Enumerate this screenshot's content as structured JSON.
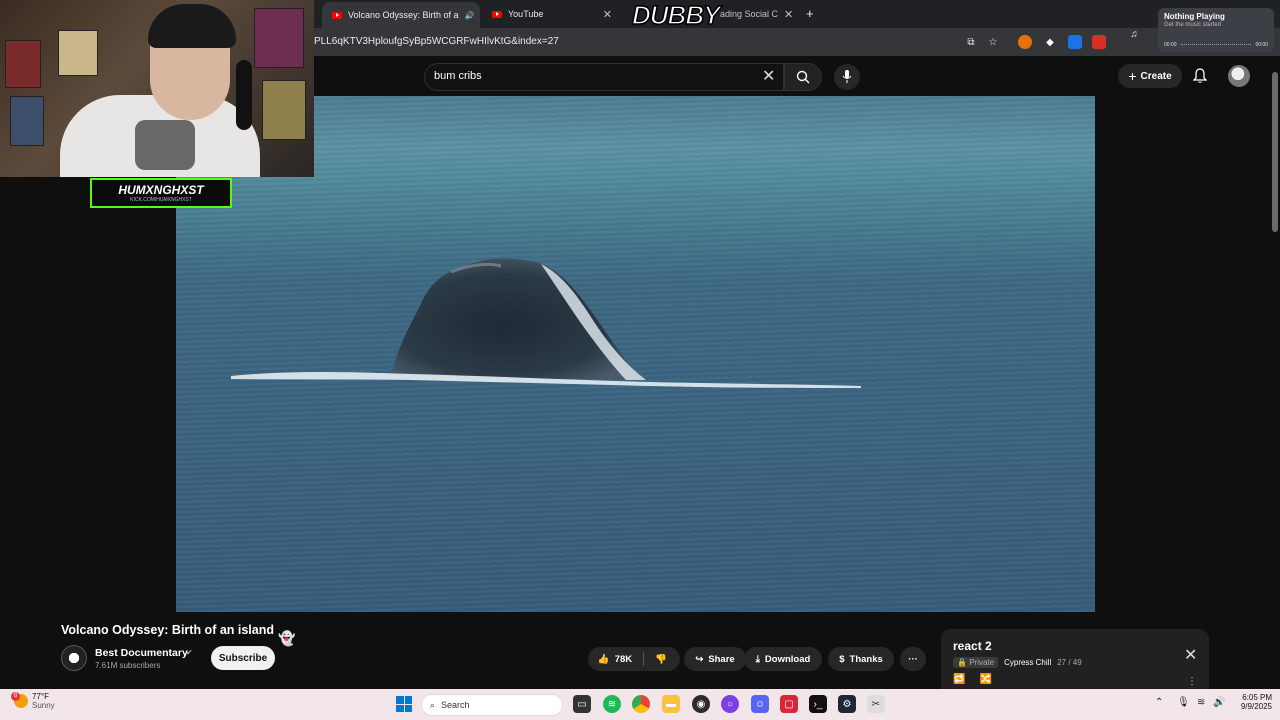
{
  "browser": {
    "tabs": [
      {
        "label": "Volcano Odyssey: Birth of a",
        "active": true
      },
      {
        "label": "YouTube",
        "active": false
      },
      {
        "label": "ading Social C",
        "active": false
      }
    ],
    "new_tab": "+",
    "url": "PLL6qKTV3HploufgSyBp5WCGRFwHIlvKtG&index=27"
  },
  "now_playing": {
    "title": "Nothing Playing",
    "subtitle": "Get the music started",
    "time_start": "00:00",
    "time_end": "00:00"
  },
  "overlay": {
    "streamer_name": "HUMXNGHXST",
    "streamer_link": "KICK.COM/HUMXNGHXST",
    "brand": "DUBBY"
  },
  "youtube": {
    "search_value": "bum cribs",
    "create_label": "Create",
    "video_title": "Volcano Odyssey: Birth of an island",
    "channel_name": "Best Documentary",
    "subscribers": "7.61M subscribers",
    "subscribe_label": "Subscribe",
    "like_count": "78K",
    "share_label": "Share",
    "download_label": "Download",
    "thanks_label": "Thanks",
    "more_label": "···"
  },
  "playlist": {
    "title": "react 2",
    "privacy": "Private",
    "owner": "Cypress Chill",
    "position": "27 / 49"
  },
  "taskbar": {
    "temperature": "77°F",
    "condition": "Sunny",
    "weather_badge": "8",
    "search_label": "Search",
    "time": "6:05 PM",
    "date": "9/9/2025"
  },
  "colors": {
    "youtube_red": "#ff0000",
    "kick_green": "#53fc18",
    "background": "#0f0f0f"
  }
}
